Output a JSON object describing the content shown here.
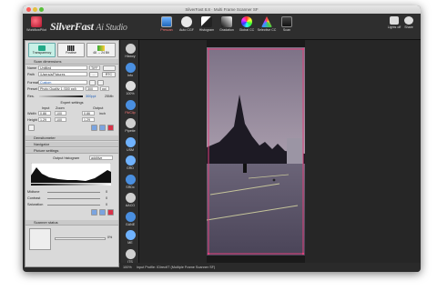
{
  "window": {
    "title": "SilverFast 8.8 · Multi Frame Scanner SF"
  },
  "brand": {
    "name": "SilverFast",
    "suffix": "Ai Studio"
  },
  "toolbar": {
    "workflowpilot": "WorkflowPilot",
    "prescan": "Prescan",
    "auto_cgf": "Auto CGF",
    "histogram": "Histogram",
    "gradation": "Gradation",
    "global_cc": "Global CC",
    "selective_cc": "Selective CC",
    "scan": "Scan",
    "lights_off": "Lights off",
    "share": "Share"
  },
  "mode_buttons": {
    "transparency": "Transparency",
    "positive": "Positive",
    "bit_depth": "48 → 24 Bit"
  },
  "scan_dimensions": {
    "header": "Scan dimensions",
    "name_label": "Name",
    "name_value": "Untitled",
    "format_badge": "TIFF",
    "path_label": "Path",
    "path_value": "/Users/a/Pictures",
    "path_btn": "...",
    "format_btn": "RTC",
    "format_label": "Format",
    "format_value": "Custom",
    "preset_label": "Preset",
    "preset_value": "Photo Quality 1 (300 ppi)",
    "preset_res": "300",
    "preset_unit": "ppi",
    "res_label": "Res.",
    "res_value": "300ppi",
    "res_size": "25Mb",
    "expert_label": "Expert settings",
    "input_label": "Input",
    "zoom_label": "Zoom",
    "output_label": "Output",
    "width_label": "Width",
    "height_label": "Height",
    "width_input": "0.86",
    "height_input": "1.29",
    "zoom_w": "100",
    "zoom_h": "100",
    "width_output": "0.86",
    "height_output": "1.29",
    "unit": "inch"
  },
  "sections": {
    "densitometer": "Densitometer",
    "navigator": "Navigator",
    "picture_settings": "Picture settings",
    "scanner_status": "Scanner status"
  },
  "picture": {
    "output_histogram": "Output histogram",
    "histogram_mode": "additive",
    "midtone": "Midtone",
    "contrast": "Contrast",
    "saturation": "Saturation",
    "midtone_value": "0",
    "contrast_value": "0",
    "saturation_value": "0"
  },
  "scanner": {
    "progress_label": "0%",
    "progress": 0
  },
  "sidebar": {
    "items": [
      "History",
      "Info",
      "100%",
      "Fit/Clip",
      "Pipette",
      "USM",
      "GRD",
      "SRDx",
      "AACO",
      "GANE",
      "ME",
      "ITS"
    ]
  },
  "status": {
    "zoom": "100%",
    "text": "Input Profile: IDirectIT (Multiple Frame Scanner SF)"
  },
  "colors": {
    "accent_red": "#d8344a",
    "frame_pink": "#e0407a",
    "panel_bg": "#d9d9d9",
    "dark_bg": "#2e2e2e"
  }
}
